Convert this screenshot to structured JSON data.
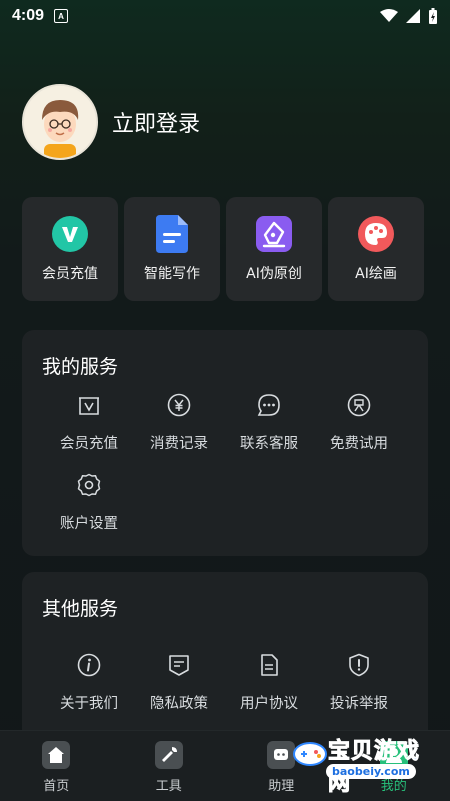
{
  "status_bar": {
    "time": "4:09",
    "badge": "A"
  },
  "profile": {
    "login_label": "立即登录"
  },
  "quick_actions": [
    {
      "label": "会员充值",
      "icon": "vip-v-icon",
      "color": "#22c6a6"
    },
    {
      "label": "智能写作",
      "icon": "document-icon",
      "color": "#3d7bf2"
    },
    {
      "label": "AI伪原创",
      "icon": "pen-nib-icon",
      "color": "#8a5cf0"
    },
    {
      "label": "AI绘画",
      "icon": "palette-icon",
      "color": "#f1595b"
    }
  ],
  "my_services": {
    "title": "我的服务",
    "items": [
      {
        "label": "会员充值",
        "icon": "vip-card-icon"
      },
      {
        "label": "消费记录",
        "icon": "yen-icon"
      },
      {
        "label": "联系客服",
        "icon": "chat-icon"
      },
      {
        "label": "免费试用",
        "icon": "free-badge-icon"
      },
      {
        "label": "账户设置",
        "icon": "gear-icon"
      }
    ]
  },
  "other_services": {
    "title": "其他服务",
    "items": [
      {
        "label": "关于我们",
        "icon": "info-icon"
      },
      {
        "label": "隐私政策",
        "icon": "policy-icon"
      },
      {
        "label": "用户协议",
        "icon": "agreement-icon"
      },
      {
        "label": "投诉举报",
        "icon": "report-shield-icon"
      }
    ]
  },
  "tabbar": [
    {
      "label": "首页",
      "icon": "home-icon"
    },
    {
      "label": "工具",
      "icon": "wrench-icon"
    },
    {
      "label": "助理",
      "icon": "assistant-icon"
    },
    {
      "label": "我的",
      "icon": "profile-icon"
    }
  ],
  "watermark": {
    "text": "宝贝游戏网",
    "url": "baobeiy.com"
  },
  "colors": {
    "accent": "#27c07b",
    "panel": "#1e2224",
    "card": "#26292b"
  }
}
